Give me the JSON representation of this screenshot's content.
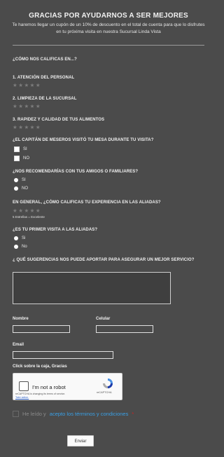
{
  "header": {
    "title": "GRACIAS POR AYUDARNOS A SER MEJORES",
    "subtitle": "Te haremos llegar un cupón de un 10% de descuento en el total de cuenta para que lo disfrutes en tu próxima visita en nuestra Sucursal Linda Vista"
  },
  "survey": {
    "intro": "¿CÓMO NOS CALIFICAS EN...?",
    "q1": "1. ATENCIÓN DEL PERSONAL",
    "q2": "2. LIMPIEZA DE LA SUCURSAL",
    "q3": "3. RAPIDEZ Y CALIDAD DE TUS ALIMENTOS",
    "stars": "★★★★★",
    "q4": "¿EL CAPITÁN DE MESEROS VISITÓ TU MESA DURANTE TU VISITA?",
    "q4_opt1": "SI",
    "q4_opt2": "NO",
    "q5": "¿NOS RECOMENDARÍAS CON TUS AMIGOS O FAMILIARES?",
    "q5_opt1": "SI",
    "q5_opt2": "NO",
    "q6": "EN GENERAL, ¿CÓMO CALIFICAS TU EXPERIENCIA EN LAS ALIADAS?",
    "q6_note": "5 Estrellas = Excelente",
    "q7": "¿ES TU PRIMER VISITA A LAS ALIADAS?",
    "q7_opt1": "Si",
    "q7_opt2": "No",
    "q8": "¿ QUÉ SUGERENCIAS NOS PUEDE APORTAR PARA ASEGURAR UN MEJOR SERVICIO?"
  },
  "fields": {
    "nombre_label": "Nombre",
    "celular_label": "Celular",
    "email_label": "Email",
    "captcha_prompt": "Click sobre la caja, Gracias"
  },
  "captcha": {
    "label": "I'm not a robot",
    "notice": "reCAPTCHA is changing its terms of service.",
    "action": "Take action.",
    "brand": "reCAPTCHA"
  },
  "terms": {
    "text": "He leído y",
    "link": "acepto los términos y condiciones",
    "required": "*"
  },
  "submit_label": "Enviar"
}
